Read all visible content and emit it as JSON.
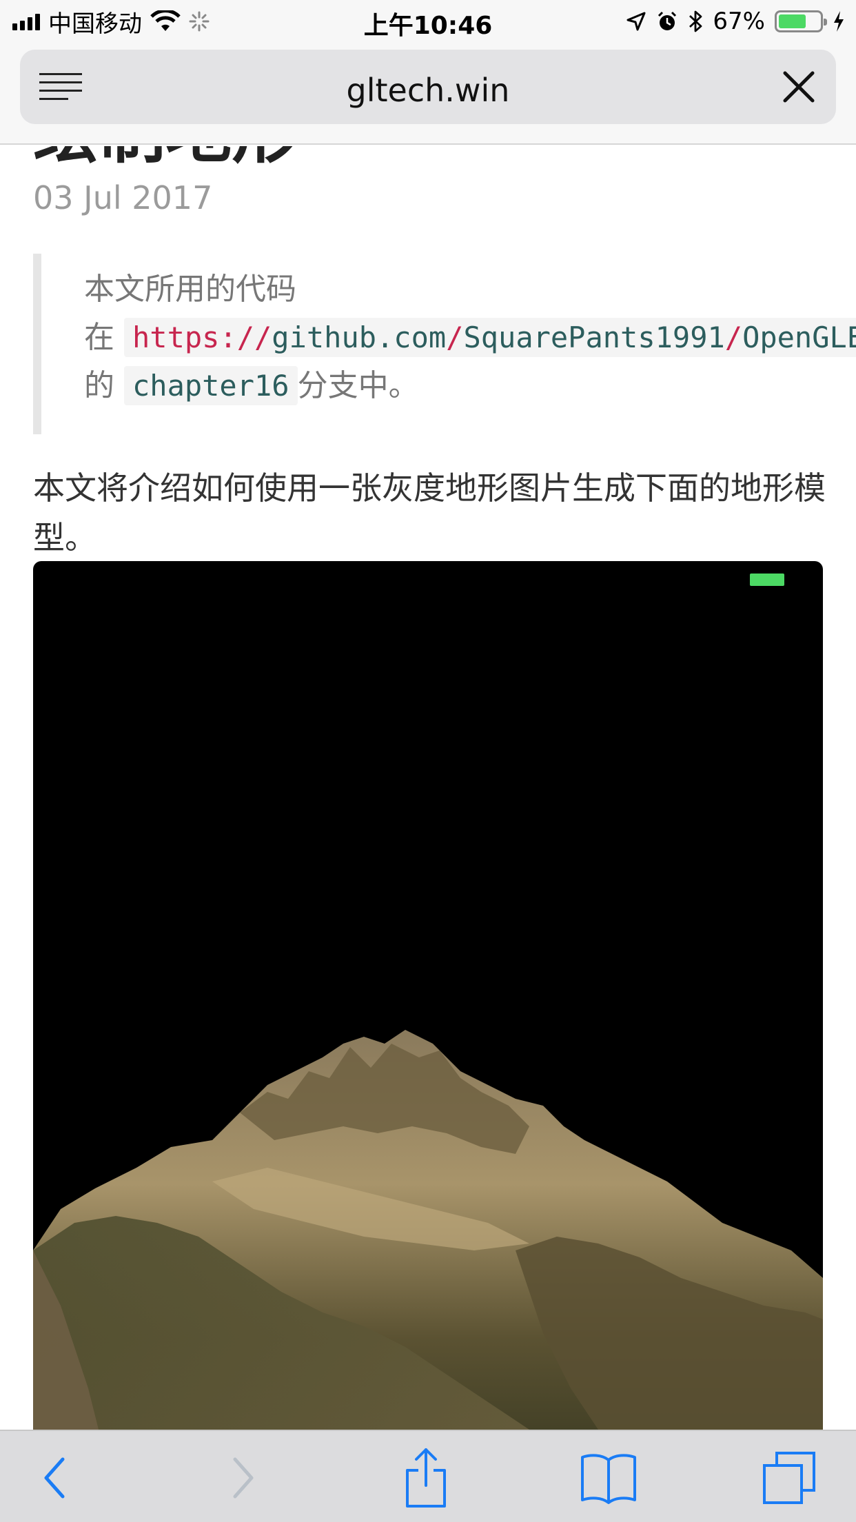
{
  "status_bar": {
    "carrier": "中国移动",
    "time": "上午10:46",
    "battery_percent": "67%",
    "battery_level": 0.67
  },
  "address_bar": {
    "url": "gltech.win"
  },
  "article": {
    "title_partial": "绘制地形",
    "date": "03 Jul 2017",
    "quote": {
      "line1": "本文所用的代码",
      "line2_prefix": "在",
      "url_parts": [
        "https:",
        "//",
        "github.com",
        "/",
        "SquarePants1991",
        "/",
        "OpenGLES"
      ],
      "line3_prefix": "的",
      "branch": "chapter16",
      "line3_suffix": "分支中。"
    },
    "paragraph": "本文将介绍如何使用一张灰度地形图片生成下面的地形模型。"
  },
  "icons": {
    "back": "chevron-left-icon",
    "forward": "chevron-right-icon",
    "share": "share-icon",
    "bookmarks": "book-icon",
    "tabs": "tabs-icon",
    "menu": "reader-menu-icon",
    "close": "close-icon"
  },
  "colors": {
    "accent": "#1a7cf5",
    "disabled": "#b9c0c8",
    "battery": "#4cd964",
    "code_red": "#c7254e"
  }
}
